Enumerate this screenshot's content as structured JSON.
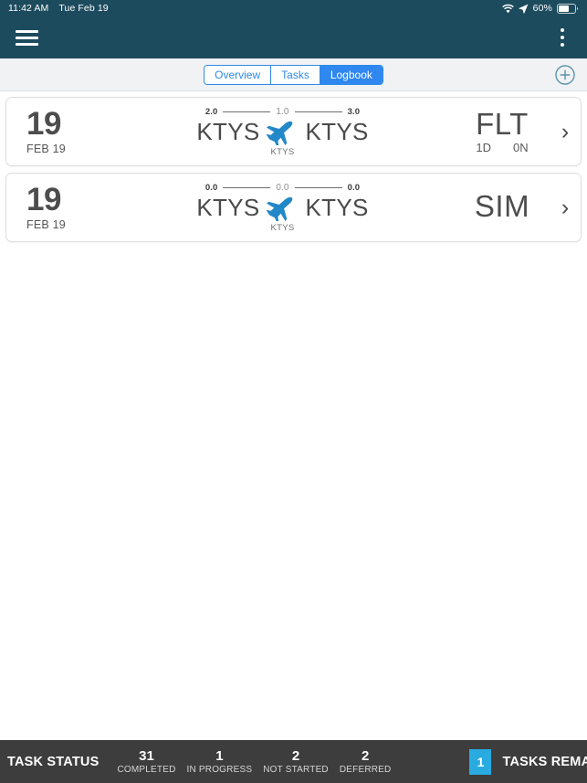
{
  "status_bar": {
    "time": "11:42 AM",
    "date": "Tue Feb 19",
    "battery_percent": "60%",
    "icons": [
      "wifi-icon",
      "location-arrow-icon",
      "battery-icon"
    ]
  },
  "app_bar": {
    "menu_icon": "hamburger-menu-icon",
    "overflow_icon": "kebab-menu-icon",
    "background_color": "#1d4b5e"
  },
  "toolbar": {
    "segments": [
      {
        "label": "Overview",
        "active": false
      },
      {
        "label": "Tasks",
        "active": false
      },
      {
        "label": "Logbook",
        "active": true
      }
    ],
    "add_icon": "plus-circle-icon",
    "accent_color": "#2f87f0"
  },
  "logbook": {
    "entries": [
      {
        "day": "19",
        "date_label": "FEB 19",
        "duration_left": "2.0",
        "duration_mid": "1.0",
        "duration_right": "3.0",
        "origin": "KTYS",
        "destination": "KTYS",
        "route_sub": "KTYS",
        "type": "FLT",
        "meta_left": "1D",
        "meta_right": "0N",
        "chevron": "›"
      },
      {
        "day": "19",
        "date_label": "FEB 19",
        "duration_left": "0.0",
        "duration_mid": "0.0",
        "duration_right": "0.0",
        "origin": "KTYS",
        "destination": "KTYS",
        "route_sub": "KTYS",
        "type": "SIM",
        "meta_left": "",
        "meta_right": "",
        "chevron": "›"
      }
    ]
  },
  "task_status_bar": {
    "title": "TASK STATUS",
    "stats": [
      {
        "value": "31",
        "label": "COMPLETED"
      },
      {
        "value": "1",
        "label": "IN PROGRESS"
      },
      {
        "value": "2",
        "label": "NOT STARTED"
      },
      {
        "value": "2",
        "label": "DEFERRED"
      }
    ],
    "remaining_count": "1",
    "remaining_label": "TASKS REMAINING",
    "badge_color": "#29abe2",
    "background_color": "#3d3d3d"
  }
}
